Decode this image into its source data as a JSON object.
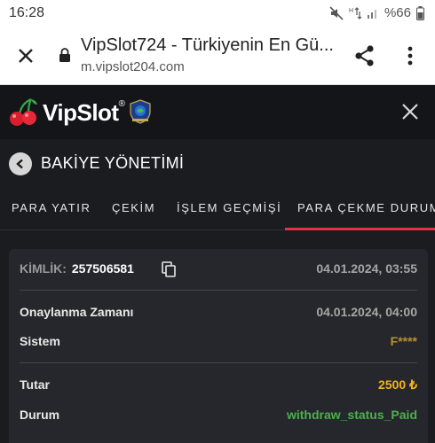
{
  "status_bar": {
    "time": "16:28",
    "battery": "%66"
  },
  "browser": {
    "page_title": "VipSlot724 - Türkiyenin En Gü...",
    "url": "m.vipslot204.com"
  },
  "site": {
    "brand_name": "VipSlot",
    "brand_mark": "®"
  },
  "section": {
    "title": "BAKİYE YÖNETİMİ"
  },
  "tabs": [
    {
      "label": "PARA YATIR",
      "active": false
    },
    {
      "label": "ÇEKİM",
      "active": false
    },
    {
      "label": "İŞLEM GEÇMİŞİ",
      "active": false
    },
    {
      "label": "PARA ÇEKME DURUMU",
      "active": true
    }
  ],
  "transaction": {
    "id_label": "KİMLİK:",
    "id_value": "257506581",
    "created_at": "04.01.2024, 03:55",
    "approval_label": "Onaylanma Zamanı",
    "approval_value": "04.01.2024, 04:00",
    "system_label": "Sistem",
    "system_value": "F****",
    "amount_label": "Tutar",
    "amount_value": "2500 ₺",
    "status_label": "Durum",
    "status_value": "withdraw_status_Paid"
  },
  "colors": {
    "accent_red": "#e2304b",
    "amount_gold": "#f2b31a",
    "system_gold": "#b8912f",
    "status_green": "#4caf50",
    "card_bg": "#26272c",
    "page_bg": "#1b1c20"
  }
}
